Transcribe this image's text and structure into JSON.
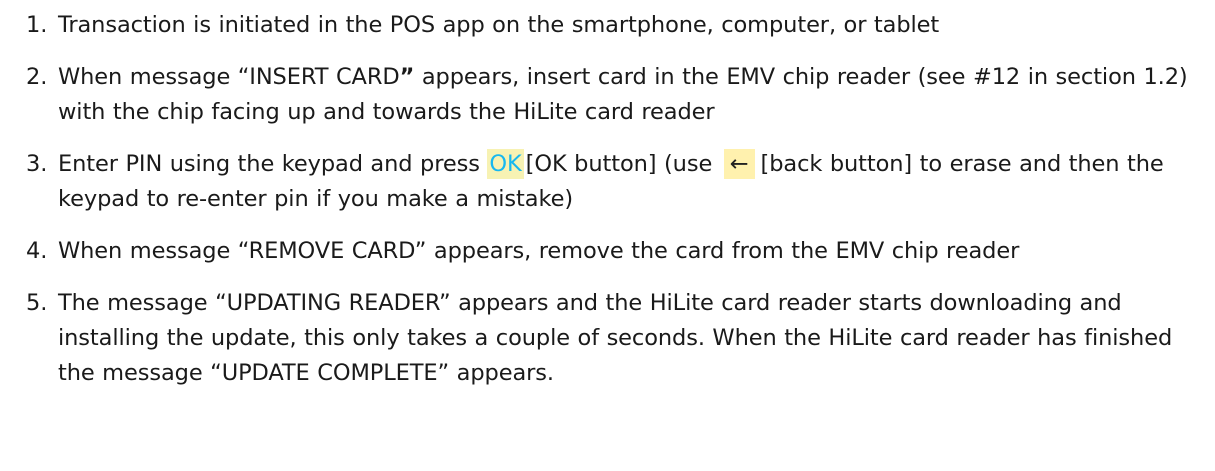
{
  "steps": [
    {
      "num": "1.",
      "text": "Transaction is initiated in the POS app on the smartphone, computer, or tablet"
    },
    {
      "num": "2.",
      "part1": "When message “INSERT CARD",
      "bold_quote": "”",
      "part2": " appears, insert card in the EMV chip reader (see #12 in section 1.2)  with the chip facing up and towards the HiLite card reader"
    },
    {
      "num": "3.",
      "part1": "Enter PIN using the keypad and press ",
      "ok_glyph": "OK",
      "part2": "[OK button] (use ",
      "back_glyph": "←",
      "part3": "[back button] to erase and then the keypad to re-enter pin if you make a mistake)"
    },
    {
      "num": "4.",
      "text": "When message “REMOVE CARD” appears, remove the card from the EMV chip reader"
    },
    {
      "num": "5.",
      "text": "The message “UPDATING READER” appears and the HiLite card reader starts downloading and installing the update, this only takes a couple of seconds. When the HiLite card reader has finished the message “UPDATE COMPLETE” appears."
    }
  ],
  "colors": {
    "ok_text": "#17b8f0",
    "icon_bg": "#f7f2b3"
  },
  "icons": {
    "ok": "ok-button-icon",
    "back": "back-arrow-icon"
  }
}
